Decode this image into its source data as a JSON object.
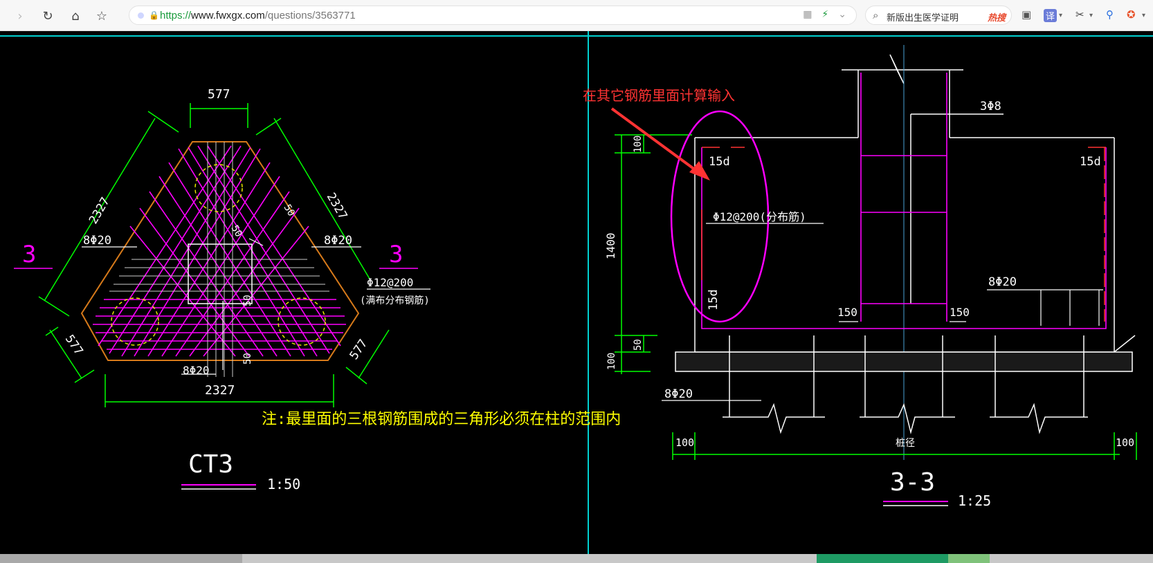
{
  "browser": {
    "url_scheme": "https://",
    "url_host": "www.fwxgx.com",
    "url_path": "/questions/3563771",
    "search_query": "新版出生医学证明",
    "search_hot_label": "热搜",
    "translate_label": "译"
  },
  "left_drawing": {
    "dim_top": "577",
    "dim_left": "2327",
    "dim_right": "2327",
    "dim_bottom": "2327",
    "dim_lower_left": "577",
    "dim_lower_right": "577",
    "bar_left": "8Φ20",
    "bar_right": "8Φ20",
    "bar_bottom": "8Φ20",
    "small_50a": "50",
    "small_50b": "50",
    "small_50c": "50",
    "small_50d": "50",
    "section_mark_left": "3",
    "section_mark_right": "3",
    "dist_bar": "Φ12@200",
    "dist_bar_note": "(满布分布钢筋)",
    "note": "注:最里面的三根钢筋围成的三角形必须在柱的范围内",
    "title": "CT3",
    "scale": "1:50"
  },
  "right_drawing": {
    "annotation": "在其它钢筋里面计算输入",
    "dim_100_top": "100",
    "dim_1400": "1400",
    "dim_50": "50",
    "dim_100_bottom": "100",
    "label_15d_tl": "15d",
    "label_15d_tr": "15d",
    "label_15d_bl": "15d",
    "bar_mid": "Φ12@200(分布筋)",
    "bar_3phi8": "3Φ8",
    "bar_8phi20_right": "8Φ20",
    "bar_8phi20_left": "8Φ20",
    "label_150_left": "150",
    "label_150_right": "150",
    "dim_100_left": "100",
    "dim_100_right": "100",
    "pile_label": "桩径",
    "title": "3-3",
    "scale": "1:25"
  },
  "colors": {
    "cad_bg": "#000000",
    "magenta": "#ff00ff",
    "green": "#00ff00",
    "white": "#ffffff",
    "yellow": "#ffff00",
    "cyan": "#00d0d0",
    "orange": "#d77a1a",
    "red": "#ff3333"
  }
}
